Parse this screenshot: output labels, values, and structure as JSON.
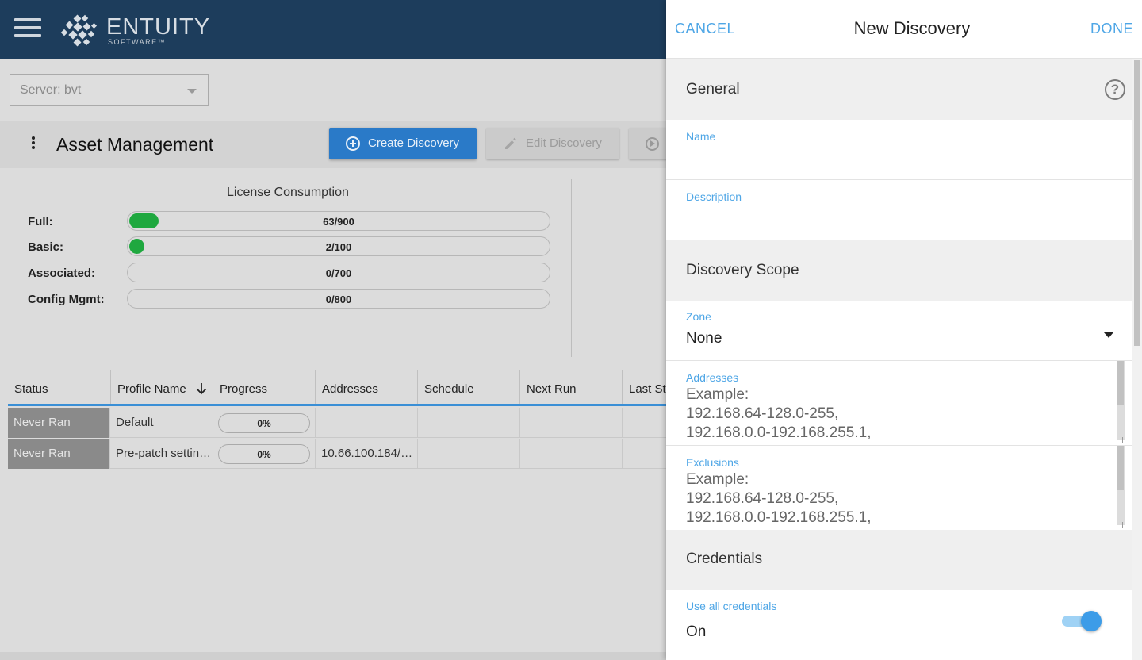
{
  "app": {
    "logo_text": "ENTUITY",
    "logo_sub": "SOFTWARE™",
    "server_select": "Server:  bvt",
    "page_title": "Asset Management",
    "toolbar": {
      "create_label": "Create Discovery",
      "edit_label": "Edit Discovery"
    },
    "license": {
      "title": "License Consumption",
      "rows": [
        {
          "label": "Full:",
          "value": "63/900",
          "used": 63,
          "total": 900
        },
        {
          "label": "Basic:",
          "value": "2/100",
          "used": 2,
          "total": 100
        },
        {
          "label": "Associated:",
          "value": "0/700",
          "used": 0,
          "total": 700
        },
        {
          "label": "Config Mgmt:",
          "value": "0/800",
          "used": 0,
          "total": 800
        }
      ]
    },
    "grid": {
      "columns": [
        "Status",
        "Profile Name",
        "Progress",
        "Addresses",
        "Schedule",
        "Next Run",
        "Last St"
      ],
      "rows": [
        {
          "status": "Never Ran",
          "profile": "Default",
          "progress": "0%",
          "addresses": ""
        },
        {
          "status": "Never Ran",
          "profile": "Pre-patch settin…",
          "progress": "0%",
          "addresses": "10.66.100.184/…"
        }
      ]
    }
  },
  "drawer": {
    "cancel_label": "CANCEL",
    "title": "New Discovery",
    "done_label": "DONE",
    "general": {
      "title": "General",
      "name_label": "Name",
      "name_value": "",
      "description_label": "Description",
      "description_value": ""
    },
    "scope": {
      "title": "Discovery Scope",
      "zone_label": "Zone",
      "zone_value": "None",
      "addresses_label": "Addresses",
      "addresses_placeholder": "Example:\n192.168.64-128.0-255,\n192.168.0.0-192.168.255.1,",
      "exclusions_label": "Exclusions",
      "exclusions_placeholder": "Example:\n192.168.64-128.0-255,\n192.168.0.0-192.168.255.1,"
    },
    "credentials": {
      "title": "Credentials",
      "use_all_label": "Use all credentials",
      "use_all_value": "On",
      "use_all_enabled": true
    }
  },
  "colors": {
    "header_bg": "#1d3d5c",
    "primary_button": "#2a7ac8",
    "accent_blue": "#4ea6e6",
    "license_fill": "#1fa83f",
    "status_never_ran": "#8a8a8a"
  }
}
